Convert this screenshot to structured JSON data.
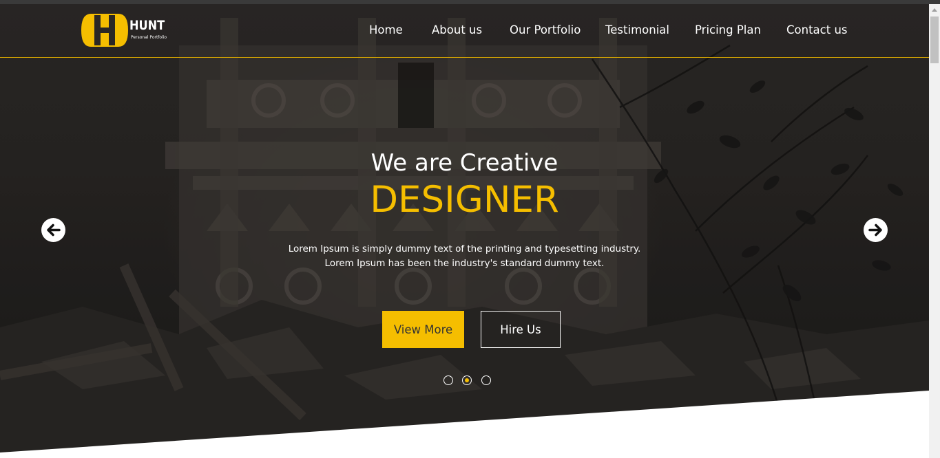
{
  "brand": {
    "title": "HUNT",
    "tagline": "Personal Portfolio",
    "accent_color": "#f5be00"
  },
  "nav": {
    "items": [
      {
        "label": "Home"
      },
      {
        "label": "About us"
      },
      {
        "label": "Our Portfolio"
      },
      {
        "label": "Testimonial"
      },
      {
        "label": "Pricing Plan"
      },
      {
        "label": "Contact us"
      }
    ]
  },
  "hero": {
    "subtitle": "We are Creative",
    "title": "DESIGNER",
    "description": "Lorem Ipsum is simply dummy text of the printing and typesetting industry. Lorem Ipsum has been the industry's standard dummy text.",
    "primary_button": "View More",
    "secondary_button": "Hire Us",
    "prev_icon": "arrow-left-icon",
    "next_icon": "arrow-right-icon",
    "slides_count": 3,
    "active_slide": 2
  }
}
